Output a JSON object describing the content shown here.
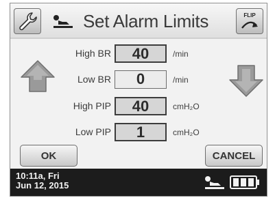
{
  "header": {
    "settings_icon": "wrench-icon",
    "title_icon": "patient-supine-icon",
    "title": "Set Alarm Limits",
    "flip_label": "FLIP",
    "flip_icon": "flip-arrow-icon"
  },
  "limits": [
    {
      "label": "High BR",
      "value": "40",
      "unit": "/min"
    },
    {
      "label": "Low BR",
      "value": "0",
      "unit": "/min"
    },
    {
      "label": "High PIP",
      "value": "40",
      "unit": "cmH₂O"
    },
    {
      "label": "Low PIP",
      "value": "1",
      "unit": "cmH₂O"
    }
  ],
  "active_field": "Low BR",
  "arrows": {
    "increase": "up-arrow-icon",
    "decrease": "down-arrow-icon"
  },
  "buttons": {
    "ok": "OK",
    "cancel": "CANCEL"
  },
  "status": {
    "time": "10:11a, Fri\nJun 12, 2015",
    "patient_icon": "patient-supine-icon",
    "battery_icon": "battery-icon",
    "battery_level": 1.0
  },
  "colors": {
    "status_bg": "#1c1c1c",
    "panel_bg": "#f2f2f2",
    "arrow_fill": "#9a9a9a"
  }
}
